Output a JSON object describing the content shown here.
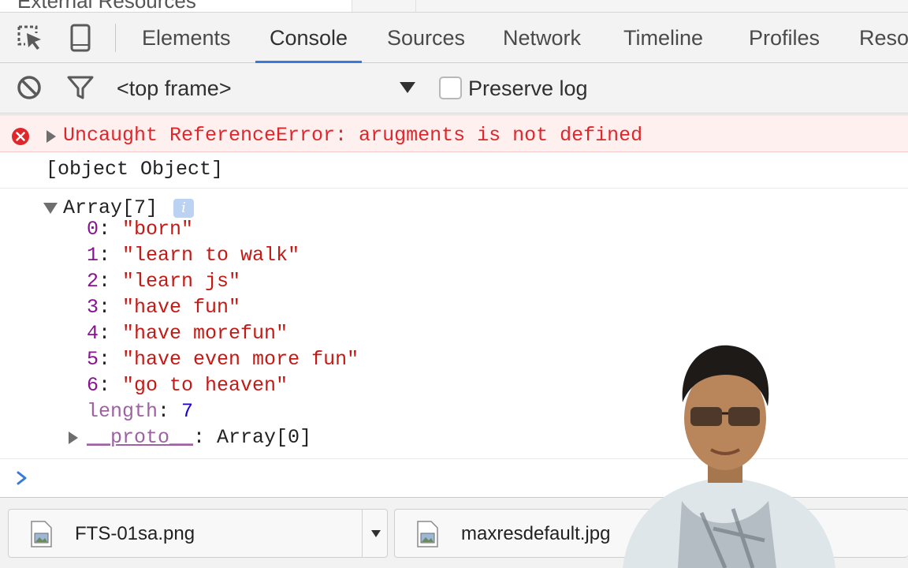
{
  "page_behind": {
    "cut_text": "External Resources"
  },
  "devtools": {
    "tabs": [
      {
        "label": "Elements"
      },
      {
        "label": "Console"
      },
      {
        "label": "Sources"
      },
      {
        "label": "Network"
      },
      {
        "label": "Timeline"
      },
      {
        "label": "Profiles"
      },
      {
        "label": "Reso"
      }
    ],
    "active_tab": "Console",
    "icons": {
      "inspect": "inspect-element-icon",
      "device": "device-mode-icon"
    }
  },
  "toolbar": {
    "context": "<top frame>",
    "preserve_log_label": "Preserve log",
    "preserve_log_checked": false,
    "icons": {
      "clear": "clear-console-icon",
      "filter": "filter-icon",
      "dropdown": "caret-down-icon"
    }
  },
  "console": {
    "error_message": "Uncaught ReferenceError: arugments is not defined",
    "log_message": "[object Object]",
    "array": {
      "label": "Array[7]",
      "info_badge": "i",
      "entries": [
        {
          "key": "0",
          "value": "\"born\""
        },
        {
          "key": "1",
          "value": "\"learn to walk\""
        },
        {
          "key": "2",
          "value": "\"learn js\""
        },
        {
          "key": "3",
          "value": "\"have fun\""
        },
        {
          "key": "4",
          "value": "\"have morefun\""
        },
        {
          "key": "5",
          "value": "\"have even more fun\""
        },
        {
          "key": "6",
          "value": "\"go to heaven\""
        }
      ],
      "length_key": "length",
      "length_value": "7",
      "proto_key": "__proto__",
      "proto_value": "Array[0]"
    },
    "colors": {
      "error": "#e0262a",
      "key": "#881391",
      "string": "#c41a16",
      "number": "#1c00cf",
      "prompt": "#3879d9"
    }
  },
  "downloads": {
    "items": [
      {
        "name": "FTS-01sa.png"
      },
      {
        "name": "maxresdefault.jpg"
      }
    ]
  }
}
